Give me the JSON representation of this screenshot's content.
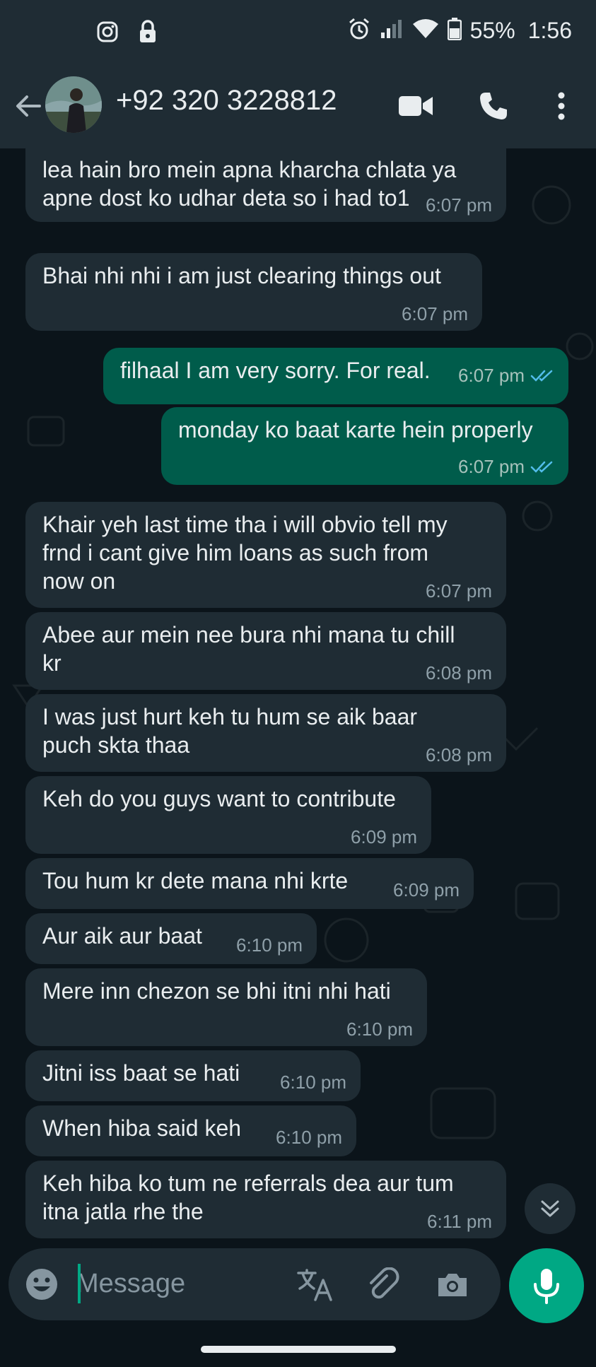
{
  "status_bar": {
    "battery": "55%",
    "time": "1:56",
    "icons": [
      "instagram-icon",
      "lock-icon",
      "alarm-icon",
      "signal-icon",
      "wifi-icon",
      "battery-icon"
    ]
  },
  "header": {
    "contact": "+92 320 3228812",
    "icons": [
      "back-arrow-icon",
      "video-call-icon",
      "phone-icon",
      "more-vert-icon"
    ]
  },
  "messages": [
    {
      "dir": "in",
      "text": "lea hain bro mein apna kharcha chlata ya\napne dost ko udhar deta so i had to1",
      "time": "6:07 pm"
    },
    {
      "dir": "in",
      "text": "Bhai nhi nhi i am just clearing things out",
      "time": "6:07 pm"
    },
    {
      "dir": "out",
      "text": "filhaal I am very sorry. For real.",
      "time": "6:07 pm",
      "status": "read"
    },
    {
      "dir": "out",
      "text": "monday ko baat karte hein properly",
      "time": "6:07 pm",
      "status": "read"
    },
    {
      "dir": "in",
      "text": "Khair yeh last time tha i will obvio tell my\nfrnd i cant give him loans as such from\nnow on",
      "time": "6:07 pm"
    },
    {
      "dir": "in",
      "text": "Abee aur mein nee bura nhi mana tu chill\nkr",
      "time": "6:08 pm"
    },
    {
      "dir": "in",
      "text": "I was just hurt keh tu hum se aik baar\npuch skta thaa",
      "time": "6:08 pm"
    },
    {
      "dir": "in",
      "text": "Keh do you guys want to contribute",
      "time": "6:09 pm"
    },
    {
      "dir": "in",
      "text": "Tou hum kr dete mana nhi krte",
      "time": "6:09 pm"
    },
    {
      "dir": "in",
      "text": "Aur aik aur baat",
      "time": "6:10 pm"
    },
    {
      "dir": "in",
      "text": "Mere inn chezon se bhi itni nhi hati",
      "time": "6:10 pm"
    },
    {
      "dir": "in",
      "text": "Jitni iss baat se hati",
      "time": "6:10 pm"
    },
    {
      "dir": "in",
      "text": "When hiba said keh",
      "time": "6:10 pm"
    },
    {
      "dir": "in",
      "text": "Keh hiba ko tum ne referrals dea aur tum\nitna jatla rhe the",
      "time": "6:11 pm"
    }
  ],
  "input": {
    "placeholder": "Message",
    "icons": [
      "emoji-icon",
      "translate-icon",
      "attach-icon",
      "camera-icon",
      "mic-icon"
    ]
  },
  "colors": {
    "header_bg": "#1f2c34",
    "chat_bg": "#0b141a",
    "incoming_bubble": "#1f2c34",
    "outgoing_bubble": "#005c4b",
    "accent": "#00a884",
    "read_tick": "#53bdeb"
  }
}
